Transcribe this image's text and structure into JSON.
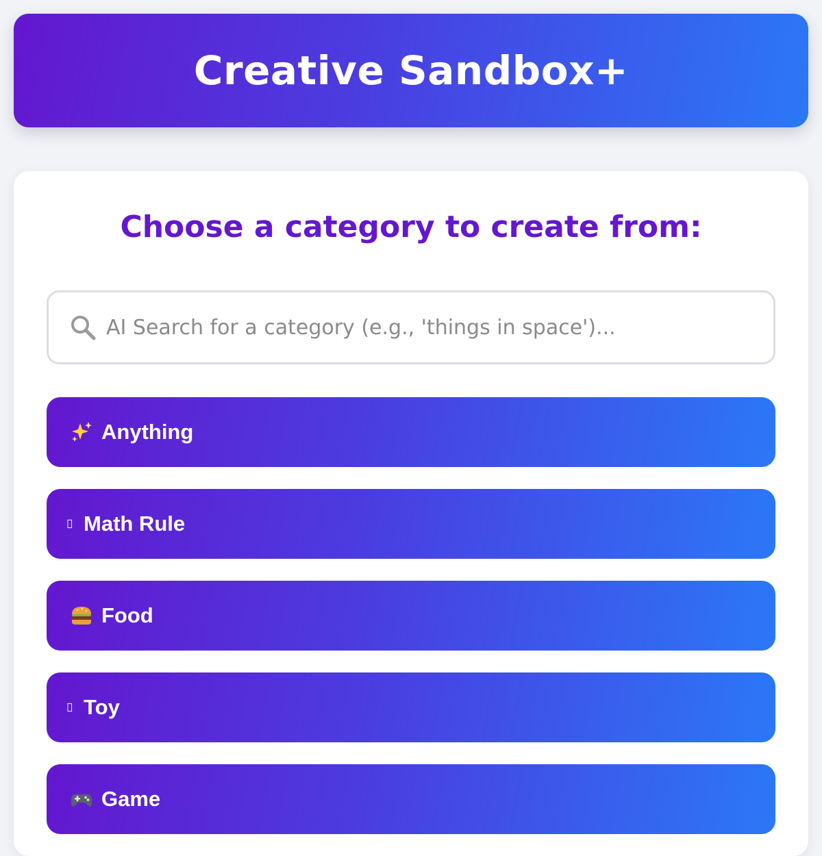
{
  "header": {
    "title": "Creative Sandbox+"
  },
  "main": {
    "heading": "Choose a category to create from:",
    "search": {
      "placeholder": "AI Search for a category (e.g., 'things in space')...",
      "value": "",
      "icon": "search-icon"
    },
    "categories": [
      {
        "label": "Anything",
        "icon": "sparkles-icon"
      },
      {
        "label": "Math Rule",
        "icon": "missing-glyph-icon"
      },
      {
        "label": "Food",
        "icon": "burger-icon"
      },
      {
        "label": "Toy",
        "icon": "missing-glyph-icon"
      },
      {
        "label": "Game",
        "icon": "game-controller-icon"
      }
    ]
  },
  "colors": {
    "gradient_start": "#6417cf",
    "gradient_mid": "#4a3ee0",
    "gradient_end": "#2b78f7",
    "heading": "#6417cf",
    "background": "#f2f3f6"
  }
}
